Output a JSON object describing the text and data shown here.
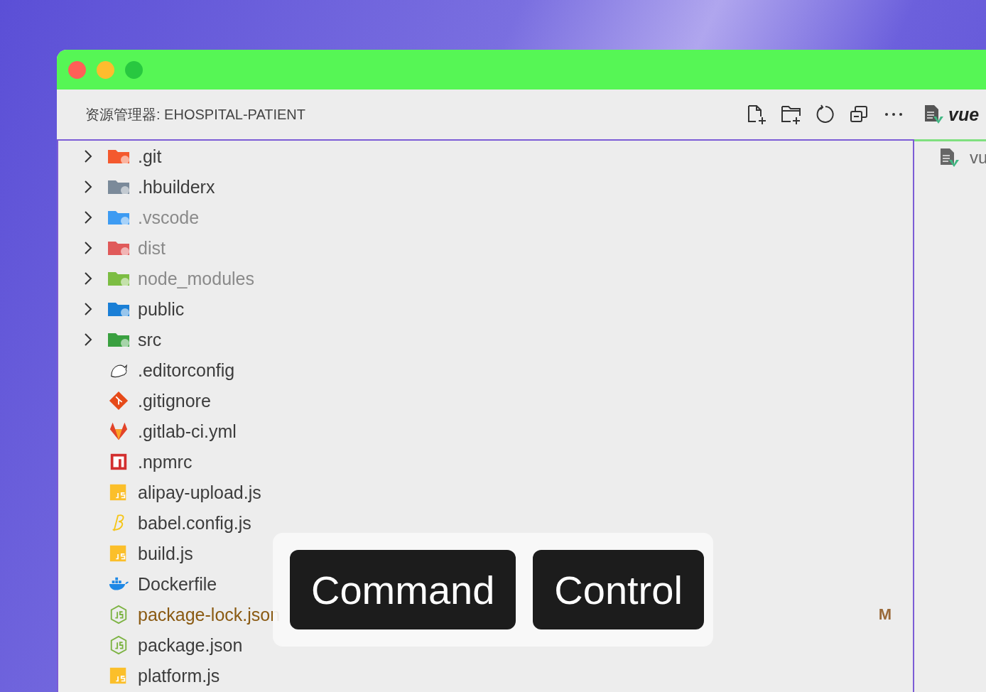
{
  "window": {
    "title": "资源管理器: EHOSPITAL-PATIENT"
  },
  "explorer": {
    "items": [
      {
        "name": ".git",
        "kind": "folder",
        "dimmed": false,
        "modified": false
      },
      {
        "name": ".hbuilderx",
        "kind": "folder",
        "dimmed": false,
        "modified": false
      },
      {
        "name": ".vscode",
        "kind": "folder",
        "dimmed": true,
        "modified": false
      },
      {
        "name": "dist",
        "kind": "folder",
        "dimmed": true,
        "modified": false
      },
      {
        "name": "node_modules",
        "kind": "folder",
        "dimmed": true,
        "modified": false
      },
      {
        "name": "public",
        "kind": "folder",
        "dimmed": false,
        "modified": false
      },
      {
        "name": "src",
        "kind": "folder",
        "dimmed": false,
        "modified": false
      },
      {
        "name": ".editorconfig",
        "kind": "file",
        "dimmed": false,
        "modified": false
      },
      {
        "name": ".gitignore",
        "kind": "file",
        "dimmed": false,
        "modified": false
      },
      {
        "name": ".gitlab-ci.yml",
        "kind": "file",
        "dimmed": false,
        "modified": false
      },
      {
        "name": ".npmrc",
        "kind": "file",
        "dimmed": false,
        "modified": false
      },
      {
        "name": "alipay-upload.js",
        "kind": "file",
        "dimmed": false,
        "modified": false
      },
      {
        "name": "babel.config.js",
        "kind": "file",
        "dimmed": false,
        "modified": false
      },
      {
        "name": "build.js",
        "kind": "file",
        "dimmed": false,
        "modified": false
      },
      {
        "name": "Dockerfile",
        "kind": "file",
        "dimmed": false,
        "modified": false
      },
      {
        "name": "package-lock.json",
        "kind": "file",
        "dimmed": false,
        "modified": true,
        "status": "M"
      },
      {
        "name": "package.json",
        "kind": "file",
        "dimmed": false,
        "modified": false
      },
      {
        "name": "platform.js",
        "kind": "file",
        "dimmed": false,
        "modified": false
      }
    ]
  },
  "editor": {
    "tab": "vue",
    "outline_item": "vu"
  },
  "key_overlay": {
    "keys": [
      "Command",
      "Control"
    ]
  }
}
